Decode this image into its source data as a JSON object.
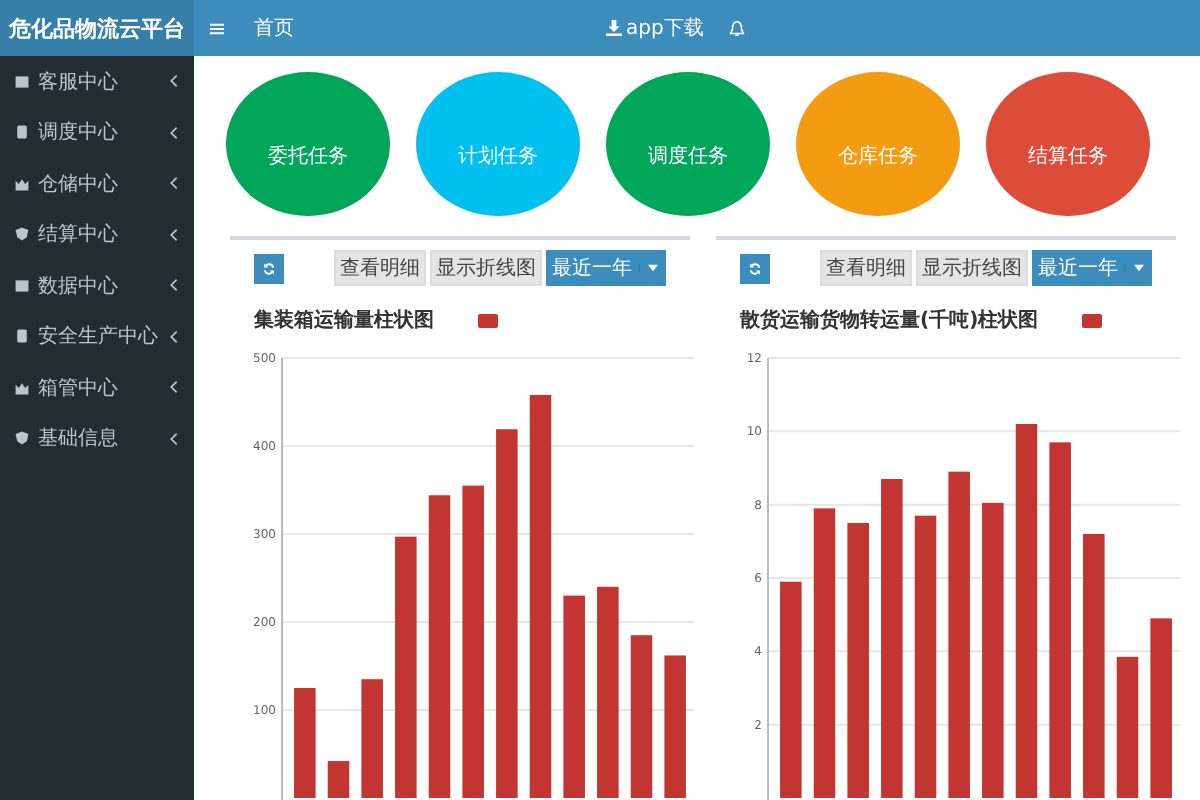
{
  "sidebar": {
    "title": "危化品物流云平台",
    "items": [
      {
        "label": "客服中心"
      },
      {
        "label": "调度中心"
      },
      {
        "label": "仓储中心"
      },
      {
        "label": "结算中心"
      },
      {
        "label": "数据中心"
      },
      {
        "label": "安全生产中心"
      },
      {
        "label": "箱管中心"
      },
      {
        "label": "基础信息"
      }
    ]
  },
  "header": {
    "breadcrumb": "首页",
    "download": "app下载"
  },
  "tasks": [
    {
      "label": "委托任务",
      "color": "#00a65a"
    },
    {
      "label": "计划任务",
      "color": "#00c0ef"
    },
    {
      "label": "调度任务",
      "color": "#00a65a"
    },
    {
      "label": "仓库任务",
      "color": "#f39c12"
    },
    {
      "label": "结算任务",
      "color": "#dd4b39"
    }
  ],
  "panels": [
    {
      "buttons": {
        "detail": "查看明细",
        "line": "显示折线图",
        "range": "最近一年"
      },
      "chart_data": {
        "type": "bar",
        "title": "集装箱运输量柱状图",
        "grid": true,
        "ylim": [
          0,
          500
        ],
        "yticks": [
          100,
          200,
          300,
          400,
          500
        ],
        "series": [
          {
            "color": "#c23531",
            "values": [
              125,
              42,
              135,
              297,
              344,
              355,
              419,
              458,
              230,
              240,
              185,
              162
            ]
          }
        ]
      }
    },
    {
      "buttons": {
        "detail": "查看明细",
        "line": "显示折线图",
        "range": "最近一年"
      },
      "chart_data": {
        "type": "bar",
        "title": "散货运输货物转运量(千吨)柱状图",
        "grid": true,
        "ylim": [
          0,
          12
        ],
        "yticks": [
          2,
          4,
          6,
          8,
          10,
          12
        ],
        "series": [
          {
            "color": "#c23531",
            "values": [
              5.9,
              7.9,
              7.5,
              8.7,
              7.7,
              8.9,
              8.05,
              10.2,
              9.7,
              7.2,
              3.85,
              4.9
            ]
          }
        ]
      }
    }
  ]
}
